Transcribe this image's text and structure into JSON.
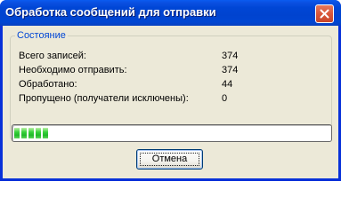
{
  "window": {
    "title": "Обработка сообщений для отправки"
  },
  "status_group": {
    "legend": "Состояние",
    "rows": [
      {
        "label": "Всего записей:",
        "value": "374"
      },
      {
        "label": "Необходимо отправить:",
        "value": "374"
      },
      {
        "label": "Обработано:",
        "value": "44"
      },
      {
        "label": "Пропущено (получатели исключены):",
        "value": "0"
      }
    ]
  },
  "progress": {
    "value": 44,
    "max": 374,
    "color": "#2ec93a"
  },
  "buttons": {
    "cancel_label": "Отмена"
  },
  "icons": {
    "close": "close-icon"
  }
}
